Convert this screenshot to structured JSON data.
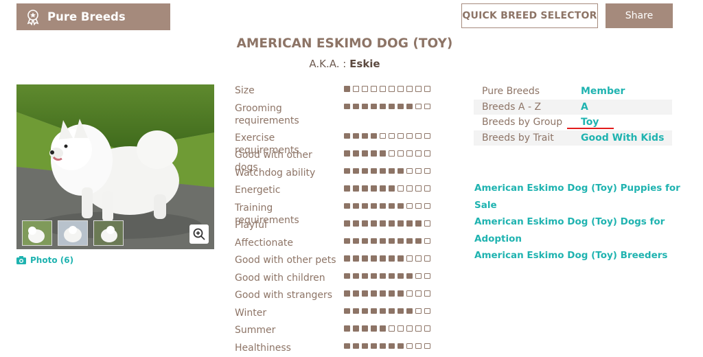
{
  "header": {
    "banner_label": "Pure Breeds",
    "banner_icon": "award-ribbon-icon",
    "quick_selector_label": "QUICK BREED SELECTOR",
    "share_label": "Share"
  },
  "breed": {
    "name": "AMERICAN ESKIMO DOG (TOY)",
    "aka_label": "A.K.A. :",
    "aka_value": "Eskie"
  },
  "photo": {
    "link_label": "Photo (6)",
    "zoom_icon": "zoom-in-icon",
    "camera_icon": "camera-icon"
  },
  "traits": [
    {
      "name": "Size",
      "level": 1
    },
    {
      "name": "Grooming requirements",
      "level": 8
    },
    {
      "name": "Exercise requirements",
      "level": 4
    },
    {
      "name": "Good with other dogs",
      "level": 5
    },
    {
      "name": "Watchdog ability",
      "level": 7
    },
    {
      "name": "Energetic",
      "level": 6
    },
    {
      "name": "Training requirements",
      "level": 7
    },
    {
      "name": "Playful",
      "level": 9
    },
    {
      "name": "Affectionate",
      "level": 9
    },
    {
      "name": "Good with other pets",
      "level": 7
    },
    {
      "name": "Good with children",
      "level": 8
    },
    {
      "name": "Good with strangers",
      "level": 7
    },
    {
      "name": "Winter",
      "level": 8
    },
    {
      "name": "Summer",
      "level": 5
    },
    {
      "name": "Healthiness",
      "level": 7
    }
  ],
  "trait_scale_max": 10,
  "info": [
    {
      "key": "Pure Breeds",
      "value": "Member"
    },
    {
      "key": "Breeds A - Z",
      "value": "A"
    },
    {
      "key": "Breeds by Group",
      "value": "Toy"
    },
    {
      "key": "Breeds by Trait",
      "value": "Good With Kids"
    }
  ],
  "links": [
    "American Eskimo Dog (Toy) Puppies for Sale",
    "American Eskimo Dog (Toy) Dogs for Adoption",
    "American Eskimo Dog (Toy) Breeders"
  ],
  "colors": {
    "brand": "#a58a7c",
    "trait_text": "#8d7466",
    "link": "#1fb3b0",
    "annotation": "#e21b1b"
  }
}
